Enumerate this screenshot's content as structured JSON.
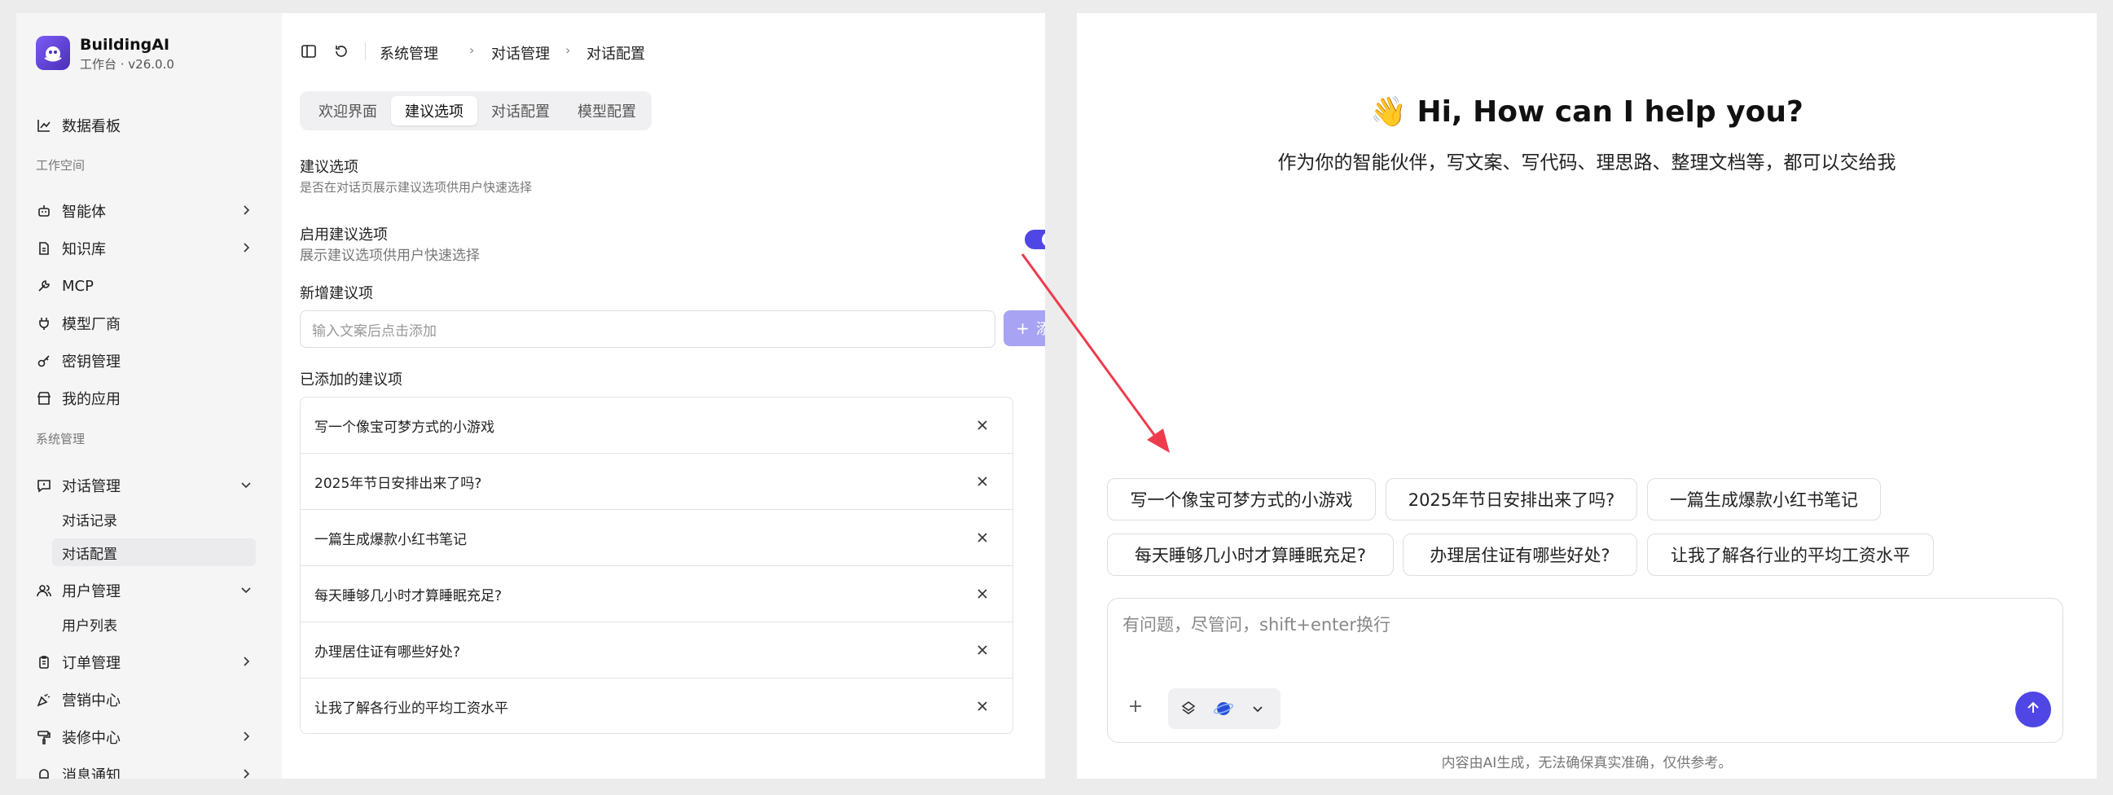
{
  "app": {
    "name": "BuildingAI",
    "subtitle": "工作台 · v26.0.0"
  },
  "sidebar": {
    "dashboard": "数据看板",
    "workspace_title": "工作空间",
    "workspace_items": [
      "智能体",
      "知识库",
      "MCP",
      "模型厂商",
      "密钥管理",
      "我的应用"
    ],
    "system_title": "系统管理",
    "chat_mgmt": "对话管理",
    "chat_sub": [
      "对话记录",
      "对话配置"
    ],
    "user_mgmt": "用户管理",
    "user_sub": [
      "用户列表"
    ],
    "order_mgmt": "订单管理",
    "marketing": "营销中心",
    "decoration": "装修中心",
    "notifications": "消息通知"
  },
  "breadcrumb": [
    "系统管理",
    "对话管理",
    "对话配置"
  ],
  "tabs": [
    "欢迎界面",
    "建议选项",
    "对话配置",
    "模型配置"
  ],
  "active_tab": "建议选项",
  "settings": {
    "section_title": "建议选项",
    "section_desc": "是否在对话页展示建议选项供用户快速选择",
    "enable_label": "启用建议选项",
    "enable_desc": "展示建议选项供用户快速选择",
    "enabled": true,
    "new_label": "新增建议项",
    "input_placeholder": "输入文案后点击添加",
    "add_button": "添加",
    "added_label": "已添加的建议项",
    "items": [
      "写一个像宝可梦方式的小游戏",
      "2025年节日安排出来了吗?",
      "一篇生成爆款小红书笔记",
      "每天睡够几小时才算睡眠充足?",
      "办理居住证有哪些好处?",
      "让我了解各行业的平均工资水平"
    ]
  },
  "preview": {
    "title": "👋 Hi, How can I help you?",
    "subtitle": "作为你的智能伙伴，写文案、写代码、理思路、整理文档等，都可以交给我",
    "chips_row1": [
      "写一个像宝可梦方式的小游戏",
      "2025年节日安排出来了吗?",
      "一篇生成爆款小红书笔记"
    ],
    "chips_row2": [
      "每天睡够几小时才算睡眠充足?",
      "办理居住证有哪些好处?",
      "让我了解各行业的平均工资水平"
    ],
    "composer_placeholder": "有问题，尽管问，shift+enter换行",
    "footer": "内容由AI生成，无法确保真实准确，仅供参考。"
  },
  "colors": {
    "accent": "#4f46e5",
    "add_button_disabled": "#a8a3f2",
    "arrow": "#ef3b4e"
  }
}
